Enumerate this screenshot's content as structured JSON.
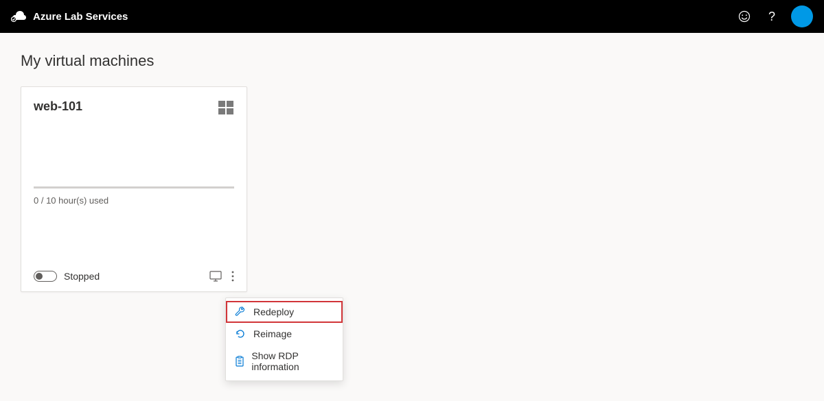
{
  "header": {
    "product_name": "Azure Lab Services"
  },
  "page": {
    "title": "My virtual machines"
  },
  "vm": {
    "name": "web-101",
    "usage": "0 / 10 hour(s) used",
    "status": "Stopped"
  },
  "menu": {
    "redeploy": "Redeploy",
    "reimage": "Reimage",
    "show_rdp": "Show RDP information"
  }
}
